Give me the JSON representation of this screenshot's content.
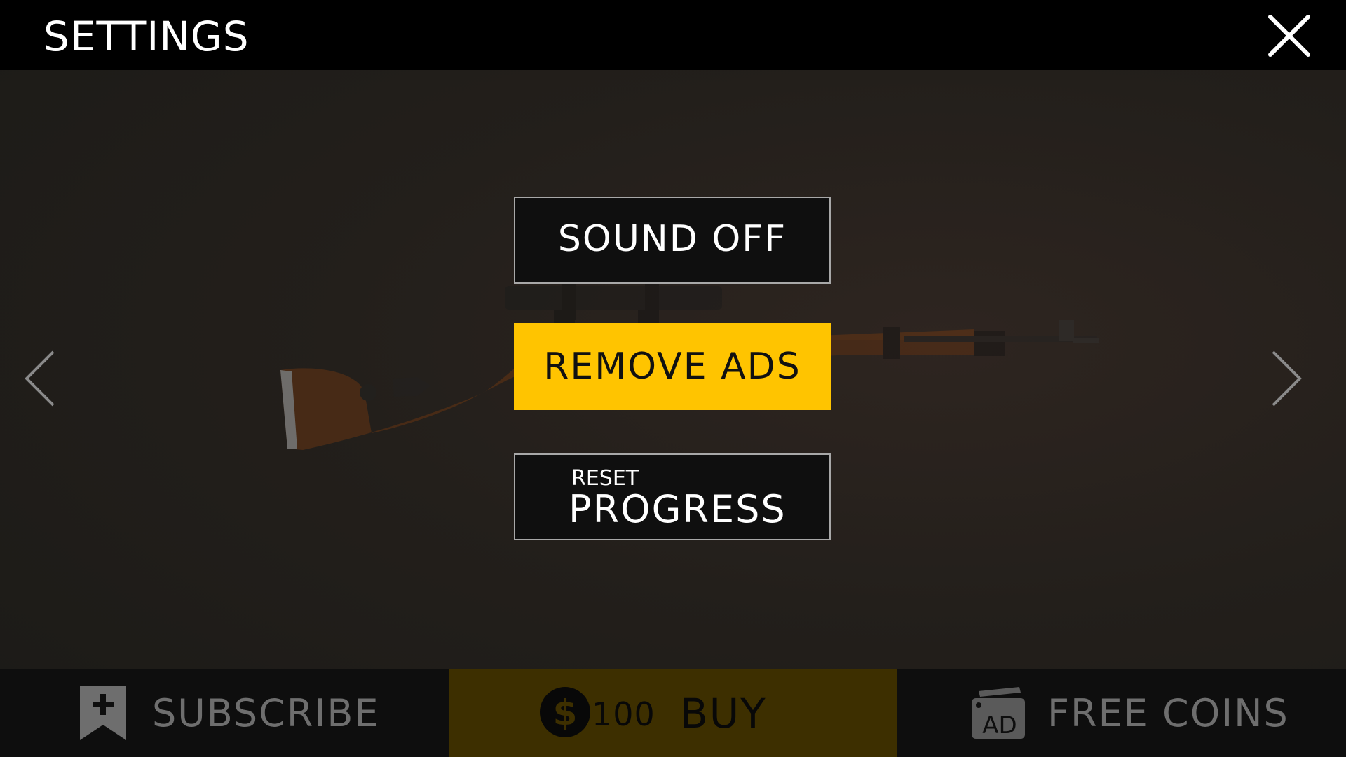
{
  "header": {
    "title": "SETTINGS"
  },
  "menu": {
    "sound_label": "SOUND OFF",
    "remove_ads_label": "REMOVE ADS",
    "reset_small": "RESET",
    "reset_big": "PROGRESS"
  },
  "bottom": {
    "subscribe_label": "SUBSCRIBE",
    "price": "100",
    "buy_label": "BUY",
    "free_coins_label": "FREE COINS"
  },
  "icons": {
    "close": "close-icon",
    "prev": "chevron-left-icon",
    "next": "chevron-right-icon",
    "subscribe": "bookmark-plus-icon",
    "coin": "dollar-coin-icon",
    "ad": "ad-video-icon"
  },
  "colors": {
    "accent": "#ffc400",
    "buy_bg": "#3d2f00",
    "bar_bg": "#000000"
  }
}
